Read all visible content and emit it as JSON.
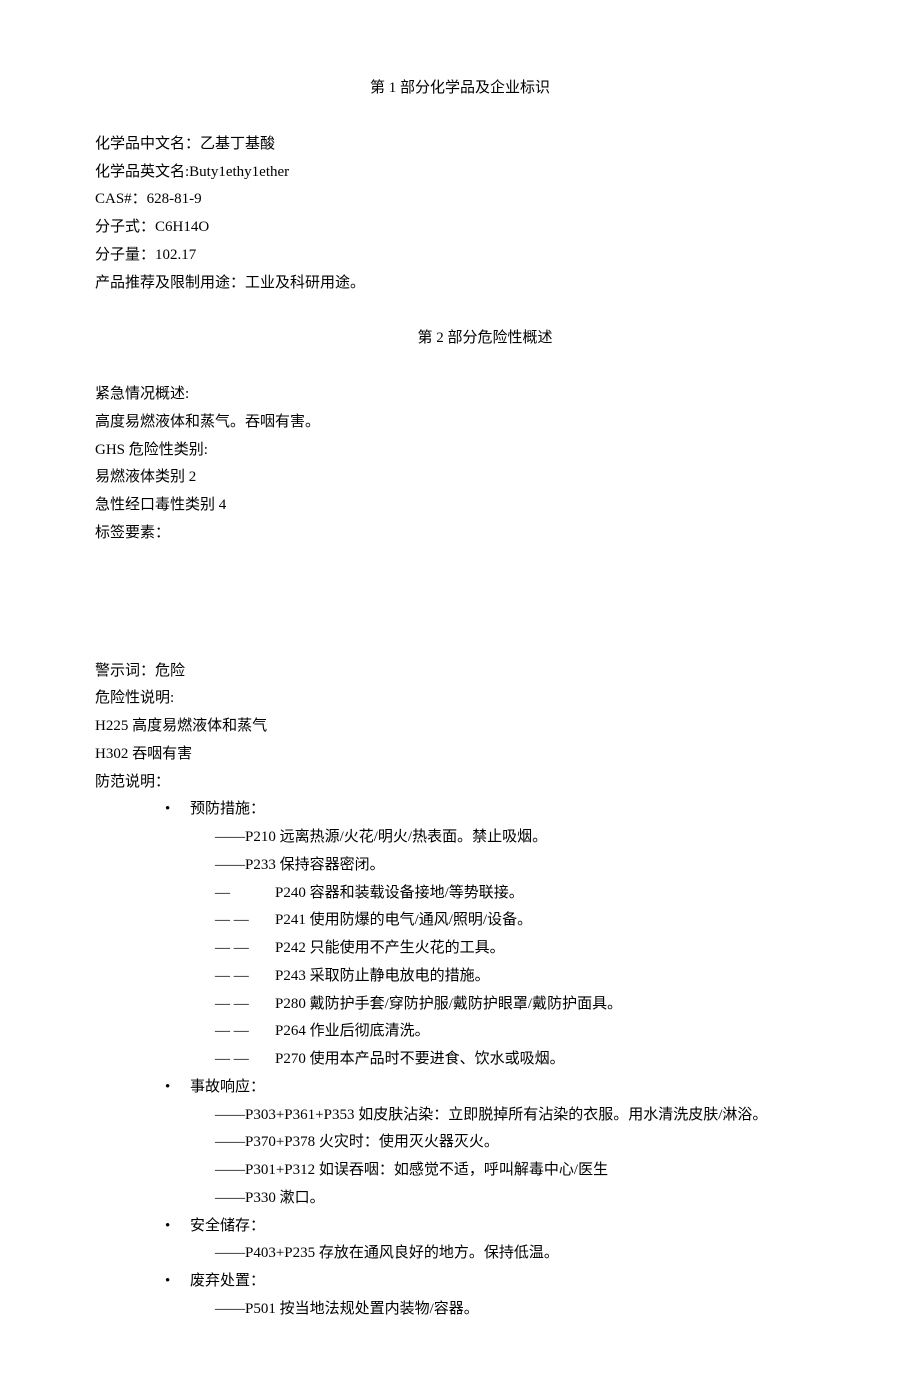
{
  "section1": {
    "title": "第 1 部分化学品及企业标识",
    "lines": {
      "name_cn": "化学品中文名：乙基丁基酸",
      "name_en": "化学品英文名:Buty1ethy1ether",
      "cas": "CAS#：628-81-9",
      "formula": "分子式：C6H14O",
      "weight": "分子量：102.17",
      "use": "产品推荐及限制用途：工业及科研用途。"
    }
  },
  "section2": {
    "title": "第 2 部分危险性概述",
    "emergency_label": "紧急情况概述:",
    "emergency_text": "高度易燃液体和蒸气。吞咽有害。",
    "ghs_label": "GHS 危险性类别:",
    "ghs_1": "易燃液体类别 2",
    "ghs_2": "急性经口毒性类别 4",
    "tag_label": "标签要素：",
    "signal": "警示词：危险",
    "hazard_label": "危险性说明:",
    "h225": "H225 高度易燃液体和蒸气",
    "h302": "H302 吞咽有害",
    "prevention_label": "防范说明：",
    "categories": {
      "prevention": "预防措施：",
      "response": "事故响应：",
      "storage": "安全储存：",
      "disposal": "废弃处置："
    },
    "prevention_items": [
      {
        "prefix": "——",
        "text": "P210 远离热源/火花/明火/热表面。禁止吸烟。"
      },
      {
        "prefix": "——",
        "text": "P233 保持容器密闭。"
      },
      {
        "prefix": "—",
        "text": "P240 容器和装载设备接地/等势联接。"
      },
      {
        "prefix": "—    —",
        "text": "P241 使用防爆的电气/通风/照明/设备。"
      },
      {
        "prefix": "—    —",
        "text": "P242 只能使用不产生火花的工具。"
      },
      {
        "prefix": "—    —",
        "text": "P243 采取防止静电放电的措施。"
      },
      {
        "prefix": "—    —",
        "text": "P280 戴防护手套/穿防护服/戴防护眼罩/戴防护面具。"
      },
      {
        "prefix": "—    —",
        "text": "P264 作业后彻底清洗。"
      },
      {
        "prefix": "—    —",
        "text": "P270 使用本产品时不要进食、饮水或吸烟。"
      }
    ],
    "response_items": [
      {
        "prefix": "——",
        "text": "P303+P361+P353 如皮肤沾染：立即脱掉所有沾染的衣服。用水清洗皮肤/淋浴。"
      },
      {
        "prefix": "——",
        "text": "P370+P378 火灾时：使用灭火器灭火。"
      },
      {
        "prefix": "——",
        "text": "P301+P312 如误吞咽：如感觉不适，呼叫解毒中心/医生"
      },
      {
        "prefix": "——",
        "text": "P330 漱口。"
      }
    ],
    "storage_items": [
      {
        "prefix": "——",
        "text": "P403+P235 存放在通风良好的地方。保持低温。"
      }
    ],
    "disposal_items": [
      {
        "prefix": "——",
        "text": "P501 按当地法规处置内装物/容器。"
      }
    ]
  }
}
